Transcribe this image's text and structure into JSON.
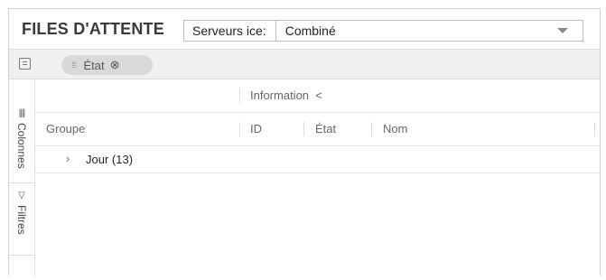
{
  "header": {
    "title": "FILES D'ATTENTE",
    "server_label": "Serveurs ice:",
    "server_value": "Combiné"
  },
  "toolbar": {
    "group_chip": "État",
    "chip_close": "⊗",
    "chip_grip": "⁞⁞⁞"
  },
  "sidebar": {
    "columns_label": "Colonnes",
    "filters_label": "Filtres"
  },
  "grid": {
    "group_header": "Information",
    "group_toggle": "<",
    "columns": [
      "Groupe",
      "ID",
      "État",
      "Nom"
    ],
    "rows": [
      {
        "label": "Jour (13)",
        "expand": "›"
      }
    ]
  }
}
